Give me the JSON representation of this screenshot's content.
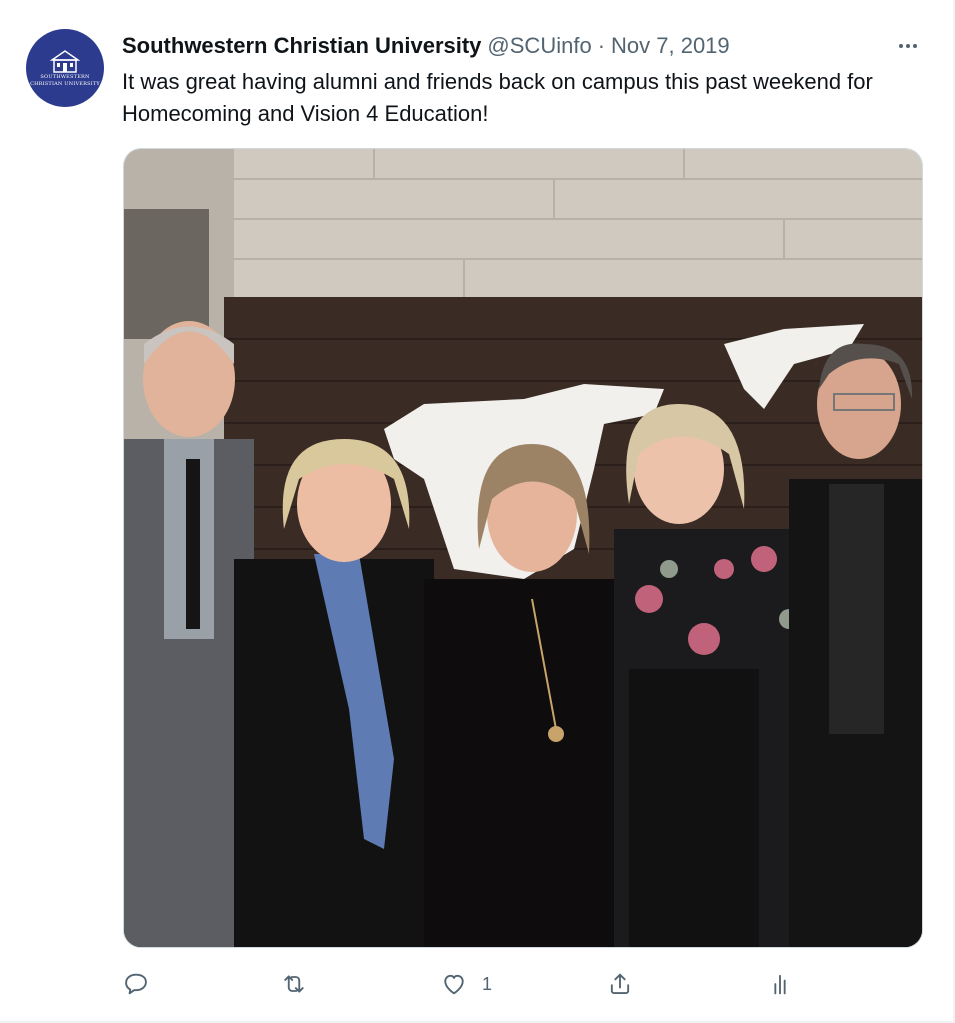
{
  "tweet": {
    "display_name": "Southwestern Christian University",
    "handle": "@SCUinfo",
    "separator": "·",
    "date": "Nov 7, 2019",
    "text": "It was great having alumni and friends back on campus this past weekend for Homecoming and Vision 4 Education!",
    "avatar_text": "SOUTHWESTERN CHRISTIAN UNIVERSITY",
    "more_icon": "more-horizontal-icon"
  },
  "actions": {
    "reply": {
      "icon": "reply-icon",
      "count": ""
    },
    "retweet": {
      "icon": "retweet-icon",
      "count": ""
    },
    "like": {
      "icon": "heart-icon",
      "count": "1"
    },
    "share": {
      "icon": "share-icon",
      "count": ""
    },
    "analytics": {
      "icon": "analytics-icon",
      "count": ""
    }
  },
  "colors": {
    "avatar_bg": "#2c3b8e",
    "text": "#0f1419",
    "secondary": "#536471",
    "border": "#cfd9de"
  }
}
